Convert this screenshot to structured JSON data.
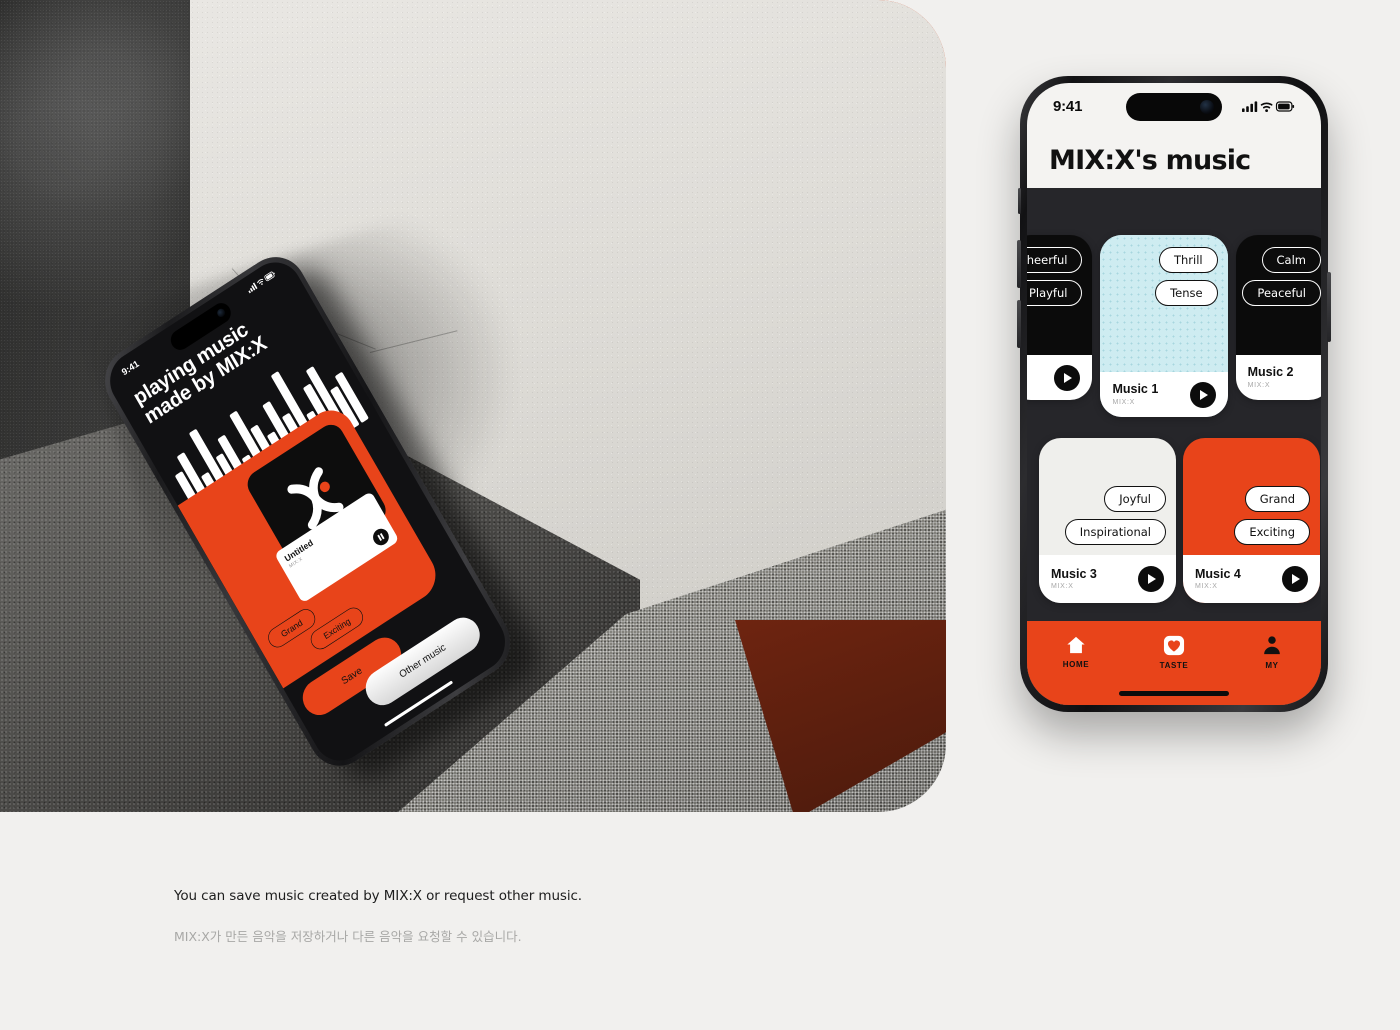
{
  "page": {
    "background_color": "#F1F0EE",
    "accent_color": "#E8441A",
    "dark_color": "#26262A"
  },
  "caption": {
    "english": "You can save music created by MIX:X or request other music.",
    "korean": "MIX:X가 만든 음악을 저장하거나 다른 음악을 요청할 수 있습니다."
  },
  "left_phone": {
    "status": {
      "time": "9:41"
    },
    "title_line1": "playing music",
    "title_line2": "made by MIX:X",
    "track": {
      "name": "Untitled",
      "artist": "MIX:X"
    },
    "tags": [
      "Grand",
      "Exciting"
    ],
    "buttons": {
      "save": "Save",
      "other": "Other music"
    }
  },
  "right_phone": {
    "status": {
      "time": "9:41"
    },
    "title": "MIX:X's music",
    "cards": [
      {
        "id": "music-0",
        "tags": [
          "Cheerful",
          "Playful"
        ],
        "title": "",
        "artist": "",
        "theme": "black"
      },
      {
        "id": "music-1",
        "tags": [
          "Thrill",
          "Tense"
        ],
        "title": "Music 1",
        "artist": "MIX:X",
        "theme": "cyan"
      },
      {
        "id": "music-2",
        "tags": [
          "Calm",
          "Peaceful"
        ],
        "title": "Music 2",
        "artist": "MIX:X",
        "theme": "black"
      },
      {
        "id": "music-3",
        "tags": [
          "Joyful",
          "Inspirational"
        ],
        "title": "Music 3",
        "artist": "MIX:X",
        "theme": "light"
      },
      {
        "id": "music-4",
        "tags": [
          "Grand",
          "Exciting"
        ],
        "title": "Music 4",
        "artist": "MIX:X",
        "theme": "orange"
      }
    ],
    "tabbar": [
      {
        "icon": "home-icon",
        "label": "HOME",
        "active": true
      },
      {
        "icon": "heart-icon",
        "label": "TASTE",
        "active": false
      },
      {
        "icon": "person-icon",
        "label": "MY",
        "active": false
      }
    ]
  }
}
